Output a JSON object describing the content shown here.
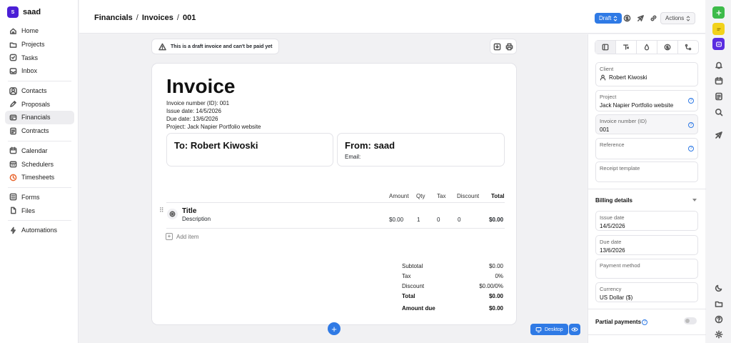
{
  "workspace": {
    "initial": "S",
    "name": "saad"
  },
  "sidebar": {
    "groups": [
      [
        {
          "label": "Home",
          "icon": "home-icon"
        },
        {
          "label": "Projects",
          "icon": "folder-icon"
        },
        {
          "label": "Tasks",
          "icon": "checkbox-icon"
        },
        {
          "label": "Inbox",
          "icon": "inbox-icon"
        }
      ],
      [
        {
          "label": "Contacts",
          "icon": "contacts-icon"
        },
        {
          "label": "Proposals",
          "icon": "proposal-icon"
        },
        {
          "label": "Financials",
          "icon": "financials-icon",
          "active": true
        },
        {
          "label": "Contracts",
          "icon": "contract-icon"
        }
      ],
      [
        {
          "label": "Calendar",
          "icon": "calendar-icon"
        },
        {
          "label": "Schedulers",
          "icon": "scheduler-icon"
        },
        {
          "label": "Timesheets",
          "icon": "timesheet-icon"
        }
      ],
      [
        {
          "label": "Forms",
          "icon": "form-icon"
        },
        {
          "label": "Files",
          "icon": "files-icon"
        }
      ],
      [
        {
          "label": "Automations",
          "icon": "automation-icon"
        }
      ]
    ]
  },
  "header": {
    "breadcrumb": [
      "Financials",
      "Invoices",
      "001"
    ],
    "separator": "/",
    "status": "Draft",
    "actions": "Actions"
  },
  "canvas": {
    "notice": "This is a draft invoice and can't be paid yet",
    "fab": "+",
    "desktop": "Desktop"
  },
  "invoice": {
    "title": "Invoice",
    "meta": [
      "Invoice number (ID): 001",
      "Issue date: 14/5/2026",
      "Due date: 13/6/2026",
      "Project: Jack Napier Portfolio website"
    ],
    "to": "To: Robert Kiwoski",
    "from": "From: saad",
    "from_email_label": "Email:",
    "columns": {
      "amount": "Amount",
      "qty": "Qty",
      "tax": "Tax",
      "discount": "Discount",
      "total": "Total"
    },
    "item": {
      "title": "Title",
      "description": "Description",
      "amount": "$0.00",
      "qty": "1",
      "tax": "0",
      "discount": "0",
      "total": "$0.00"
    },
    "add_item": "Add item",
    "summary": [
      {
        "label": "Subtotal",
        "value": "$0.00",
        "bold": false
      },
      {
        "label": "Tax",
        "value": "0%",
        "bold": false
      },
      {
        "label": "Discount",
        "value": "$0.00/0%",
        "bold": false
      },
      {
        "label": "Total",
        "value": "$0.00",
        "bold": true
      },
      {
        "label": "Amount due",
        "value": "$0.00",
        "bold": true
      }
    ]
  },
  "panel": {
    "client_label": "Client",
    "client_value": "Robert Kiwoski",
    "project_label": "Project",
    "project_value": "Jack Napier Portfolio website",
    "invoice_number_label": "Invoice number (ID)",
    "invoice_number_value": "001",
    "reference_label": "Reference",
    "receipt_label": "Receipt template",
    "billing_title": "Billing details",
    "issue_label": "Issue date",
    "issue_value": "14/5/2026",
    "due_label": "Due date",
    "due_value": "13/6/2026",
    "payment_label": "Payment method",
    "currency_label": "Currency",
    "currency_value": "US Dollar ($)",
    "partial_title": "Partial payments",
    "help": "?"
  },
  "colors": {
    "accent": "#2f7ae5",
    "workspace": "#4b1fd6",
    "rail_green": "#3dbb4a",
    "rail_yellow": "#f2d21b",
    "rail_purple": "#5a2de0"
  }
}
